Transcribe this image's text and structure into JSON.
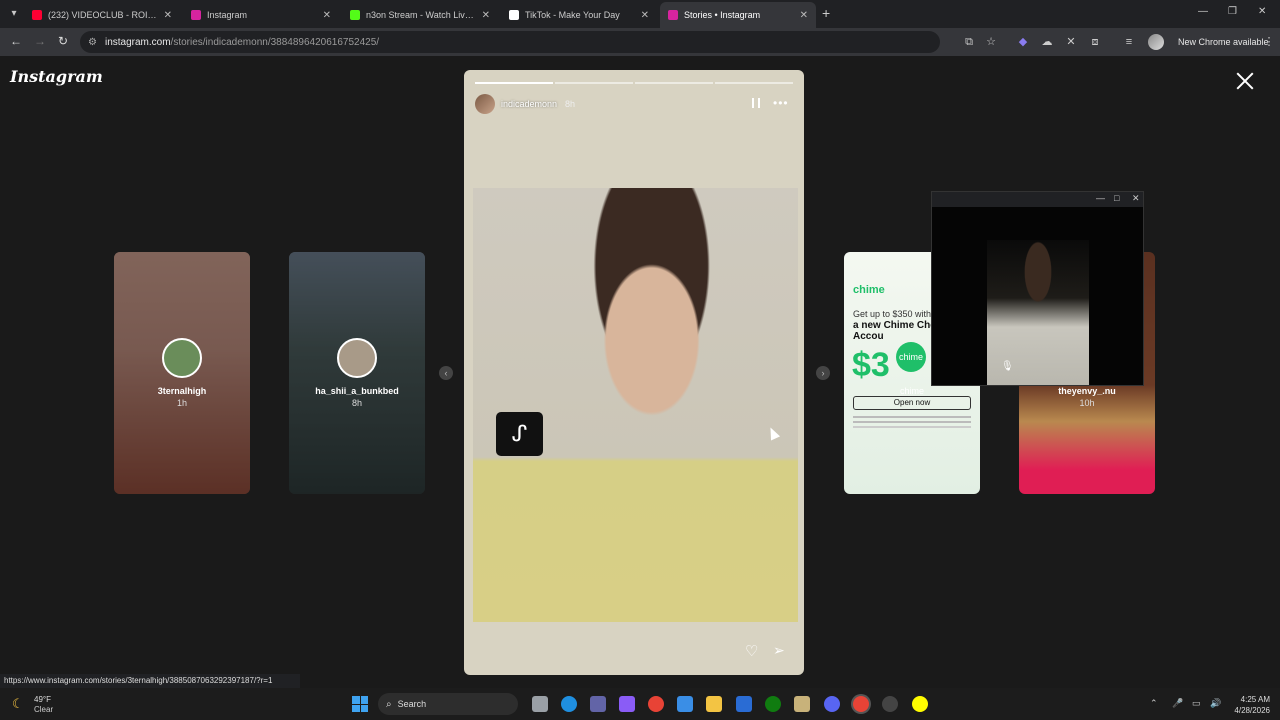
{
  "tabs": [
    {
      "title": "(232) VIDEOCLUB - ROI Instrum",
      "color": "#ff0033"
    },
    {
      "title": "Instagram",
      "color": "#d6249f"
    },
    {
      "title": "n3on Stream - Watch Live on K",
      "color": "#53fc18"
    },
    {
      "title": "TikTok - Make Your Day",
      "color": "#ffffff"
    },
    {
      "title": "Stories • Instagram",
      "color": "#d6249f"
    }
  ],
  "address": {
    "host": "instagram.com",
    "path": "/stories/indicademonn/3884896420616752425/"
  },
  "toolbar": {
    "new_chrome": "New Chrome available"
  },
  "instagram": {
    "logo": "Instagram"
  },
  "previews": [
    {
      "user": "3ternalhigh",
      "age": "1h"
    },
    {
      "user": "ha_shii_a_bunkbed",
      "age": "8h"
    },
    {
      "user": "chime",
      "age": ""
    },
    {
      "user": "theyenvy_.nu",
      "age": "10h"
    }
  ],
  "story": {
    "user": "indicademonn",
    "age": "8h",
    "progress_segments_total": 4,
    "progress_segments_done": 1
  },
  "chime_ad": {
    "brand": "chime",
    "line1": "Get up to $350 with",
    "line2": "a new Chime Checking Accou",
    "big": "$3",
    "badge": "chime",
    "button": "Open now"
  },
  "status_url": "https://www.instagram.com/stories/3ternalhigh/3885087063292397187/?r=1",
  "taskbar": {
    "temp": "49°F",
    "condition": "Clear",
    "search": "Search",
    "time": "4:25 AM",
    "date": "4/28/2026"
  }
}
